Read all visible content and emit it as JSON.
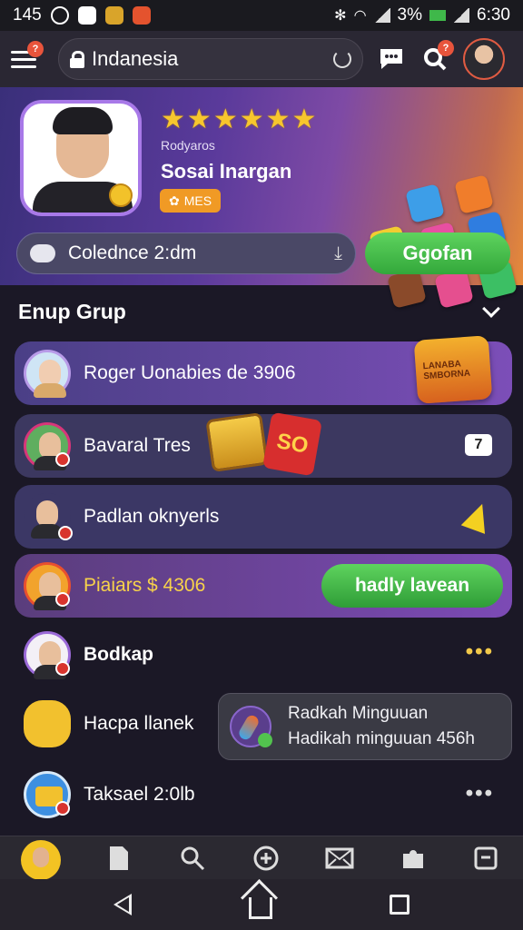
{
  "status": {
    "time_left": "145",
    "battery": "3%",
    "clock": "6:30"
  },
  "appbar": {
    "location": "Indanesia",
    "menu_badge": "?",
    "search_badge": "?"
  },
  "profile": {
    "stars": [
      "★",
      "★",
      "★",
      "★",
      "★",
      "★"
    ],
    "sub": "Rodyaros",
    "name": "Sosai Inargan",
    "tag": "MES"
  },
  "challenge": {
    "label": "Colednce 2:dm",
    "go_button": "Ggofan"
  },
  "group": {
    "title": "Enup Grup"
  },
  "rows": [
    {
      "name": "Roger Uonabies de 3906",
      "gift_label": "LANABA SMBORNA"
    },
    {
      "name": "Bavaral Tres",
      "box_label": "SO",
      "badge": "7"
    },
    {
      "name": "Padlan oknyerls"
    },
    {
      "name": "Piaiars $ 4306",
      "button": "hadly lavean"
    },
    {
      "name": "Bodkap",
      "more": "•••"
    },
    {
      "name": "Hacpa llanek"
    },
    {
      "name": "Taksael 2:0lb",
      "more": "•••"
    }
  ],
  "popup": {
    "line1": "Radkah Minguuan",
    "line2": "Hadikah minguuan 456h"
  },
  "colors": {
    "accent_green": "#3fb84a",
    "accent_purple": "#7e4aa5",
    "badge_red": "#e8543c"
  }
}
